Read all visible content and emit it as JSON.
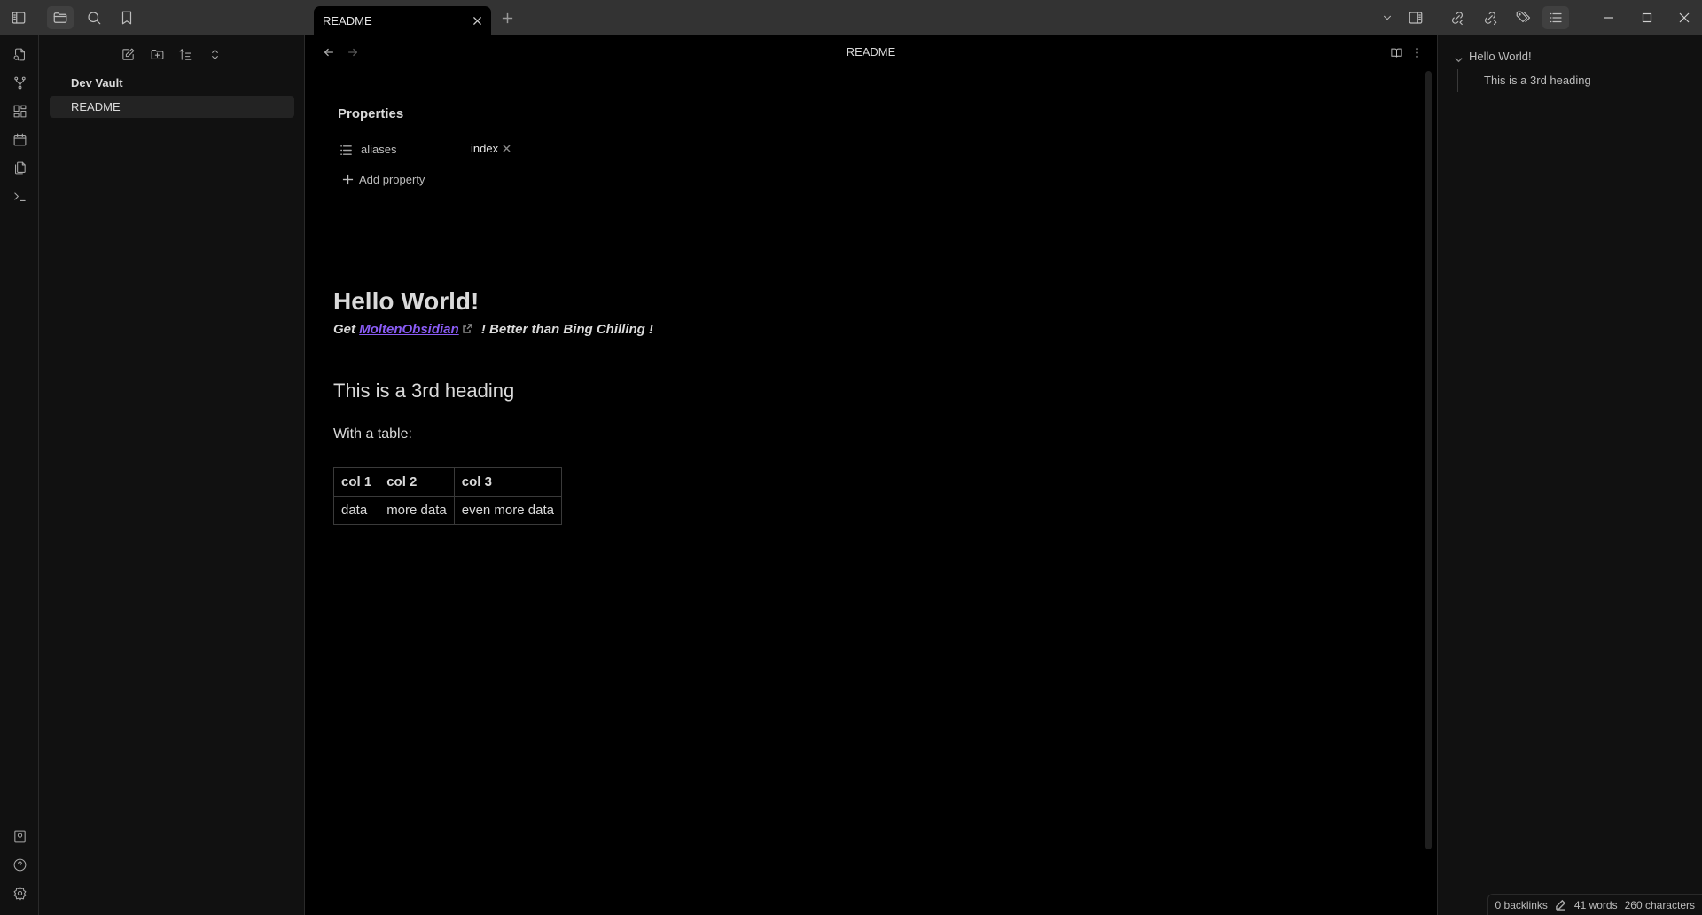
{
  "titlebar": {
    "tab_label": "README",
    "icons": [
      "sidebar-toggle-icon",
      "folder-icon",
      "search-icon",
      "bookmark-icon"
    ],
    "right_icons": [
      "chevron-down-icon",
      "right-sidebar-toggle-icon",
      "backlinks-icon",
      "outgoing-links-icon",
      "tags-icon",
      "outline-icon"
    ],
    "window_controls": [
      "minimize-icon",
      "maximize-icon",
      "close-icon"
    ]
  },
  "ribbon": {
    "top": [
      "open-quick-switcher-icon",
      "graph-view-icon",
      "canvas-icon",
      "daily-note-icon",
      "templates-icon",
      "command-palette-icon"
    ],
    "bottom": [
      "vault-switcher-icon",
      "help-icon",
      "settings-icon"
    ]
  },
  "file_explorer": {
    "actions": [
      "new-note-icon",
      "new-folder-icon",
      "sort-icon",
      "collapse-all-icon"
    ],
    "vault_name": "Dev Vault",
    "files": [
      {
        "name": "README",
        "active": true
      }
    ]
  },
  "editor": {
    "view_title": "README",
    "properties": {
      "title": "Properties",
      "items": [
        {
          "key": "aliases",
          "values": [
            "index"
          ]
        }
      ],
      "add_label": "Add property"
    },
    "doc": {
      "h1": "Hello World!",
      "sub_prefix": "Get ",
      "link_text": "MoltenObsidian",
      "sub_suffix": " ! Better than Bing Chilling !",
      "h3": "This is a 3rd heading",
      "para": "With a table:",
      "table": {
        "headers": [
          "col 1",
          "col 2",
          "col 3"
        ],
        "rows": [
          [
            "data",
            "more data",
            "even more data"
          ]
        ]
      }
    },
    "link_color": "#8a5cf5"
  },
  "outline": {
    "items": [
      {
        "label": "Hello World!",
        "level": 1
      },
      {
        "label": "This is a 3rd heading",
        "level": 3
      }
    ]
  },
  "status_bar": {
    "backlinks": "0 backlinks",
    "words": "41 words",
    "characters": "260 characters"
  }
}
